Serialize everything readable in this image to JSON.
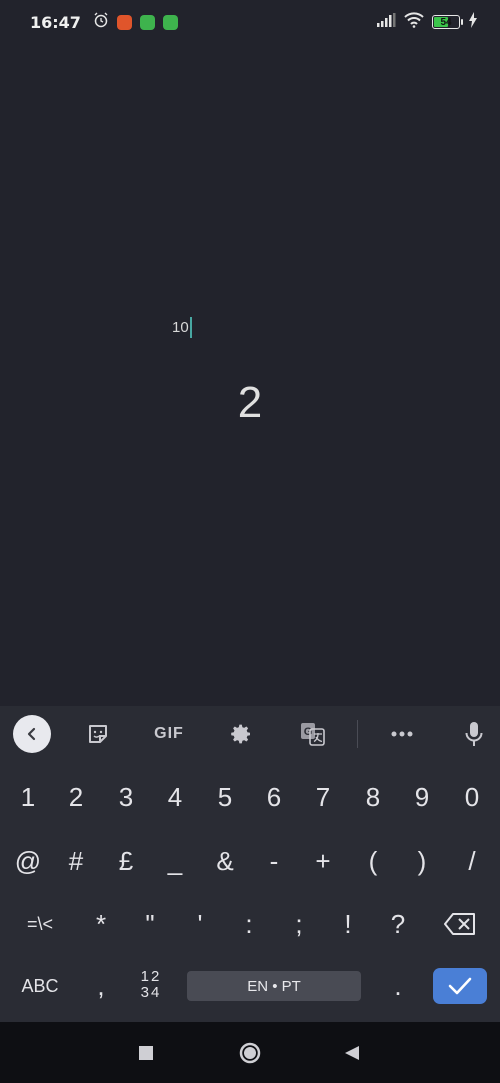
{
  "status": {
    "time": "16:47",
    "battery": "54",
    "battery_level": 0.54
  },
  "app": {
    "input_value": "10",
    "result": "2"
  },
  "toolbar": {
    "gif_label": "GIF"
  },
  "keyboard": {
    "row1": [
      "1",
      "2",
      "3",
      "4",
      "5",
      "6",
      "7",
      "8",
      "9",
      "0"
    ],
    "row2": [
      "@",
      "#",
      "£",
      "_",
      "&",
      "-",
      "+",
      "(",
      ")",
      "/"
    ],
    "row3": [
      "=\\<",
      "*",
      "\"",
      "'",
      ":",
      ";",
      "!",
      "?"
    ],
    "abc_label": "ABC",
    "comma": ",",
    "num_toggle_top": "12",
    "num_toggle_bottom": "34",
    "space_label": "EN • PT",
    "period": "."
  }
}
